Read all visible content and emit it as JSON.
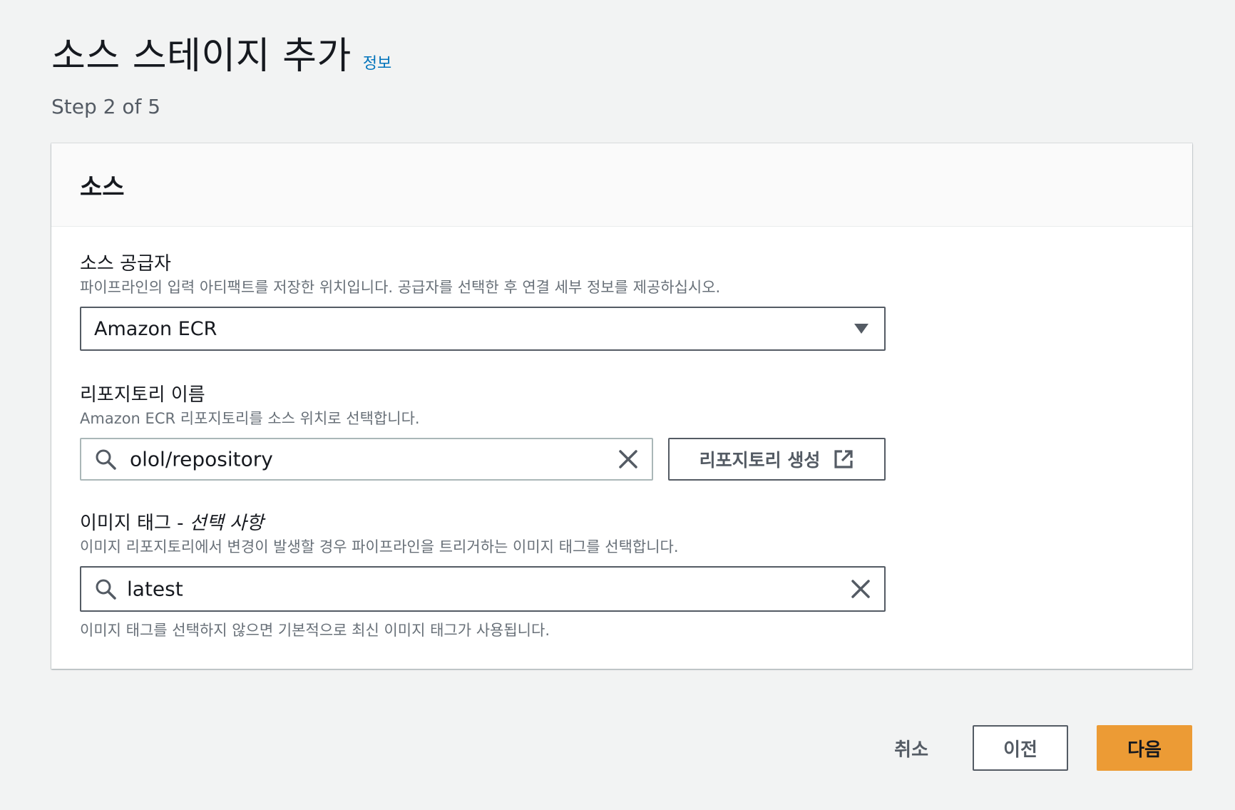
{
  "header": {
    "title": "소스 스테이지 추가",
    "info_link": "정보",
    "step": "Step 2 of 5"
  },
  "panel": {
    "title": "소스",
    "source_provider": {
      "label": "소스 공급자",
      "description": "파이프라인의 입력 아티팩트를 저장한 위치입니다. 공급자를 선택한 후 연결 세부 정보를 제공하십시오.",
      "selected_value": "Amazon ECR"
    },
    "repository": {
      "label": "리포지토리 이름",
      "description": "Amazon ECR 리포지토리를 소스 위치로 선택합니다.",
      "value": "olol/repository",
      "create_button": "리포지토리 생성"
    },
    "image_tag": {
      "label": "이미지 태그 - ",
      "label_optional": "선택 사항",
      "description": "이미지 리포지토리에서 변경이 발생할 경우 파이프라인을 트리거하는 이미지 태그를 선택합니다.",
      "value": "latest",
      "hint": "이미지 태그를 선택하지 않으면 기본적으로 최신 이미지 태그가 사용됩니다."
    }
  },
  "footer": {
    "cancel": "취소",
    "previous": "이전",
    "next": "다음"
  },
  "colors": {
    "background": "#f2f3f3",
    "link": "#0073bb",
    "primary_button": "#ec9b35",
    "text": "#16191f",
    "muted_text": "#687078"
  },
  "icons": {
    "select_caret": "caret-down-icon",
    "search": "search-icon",
    "clear": "close-icon",
    "external": "external-link-icon"
  }
}
